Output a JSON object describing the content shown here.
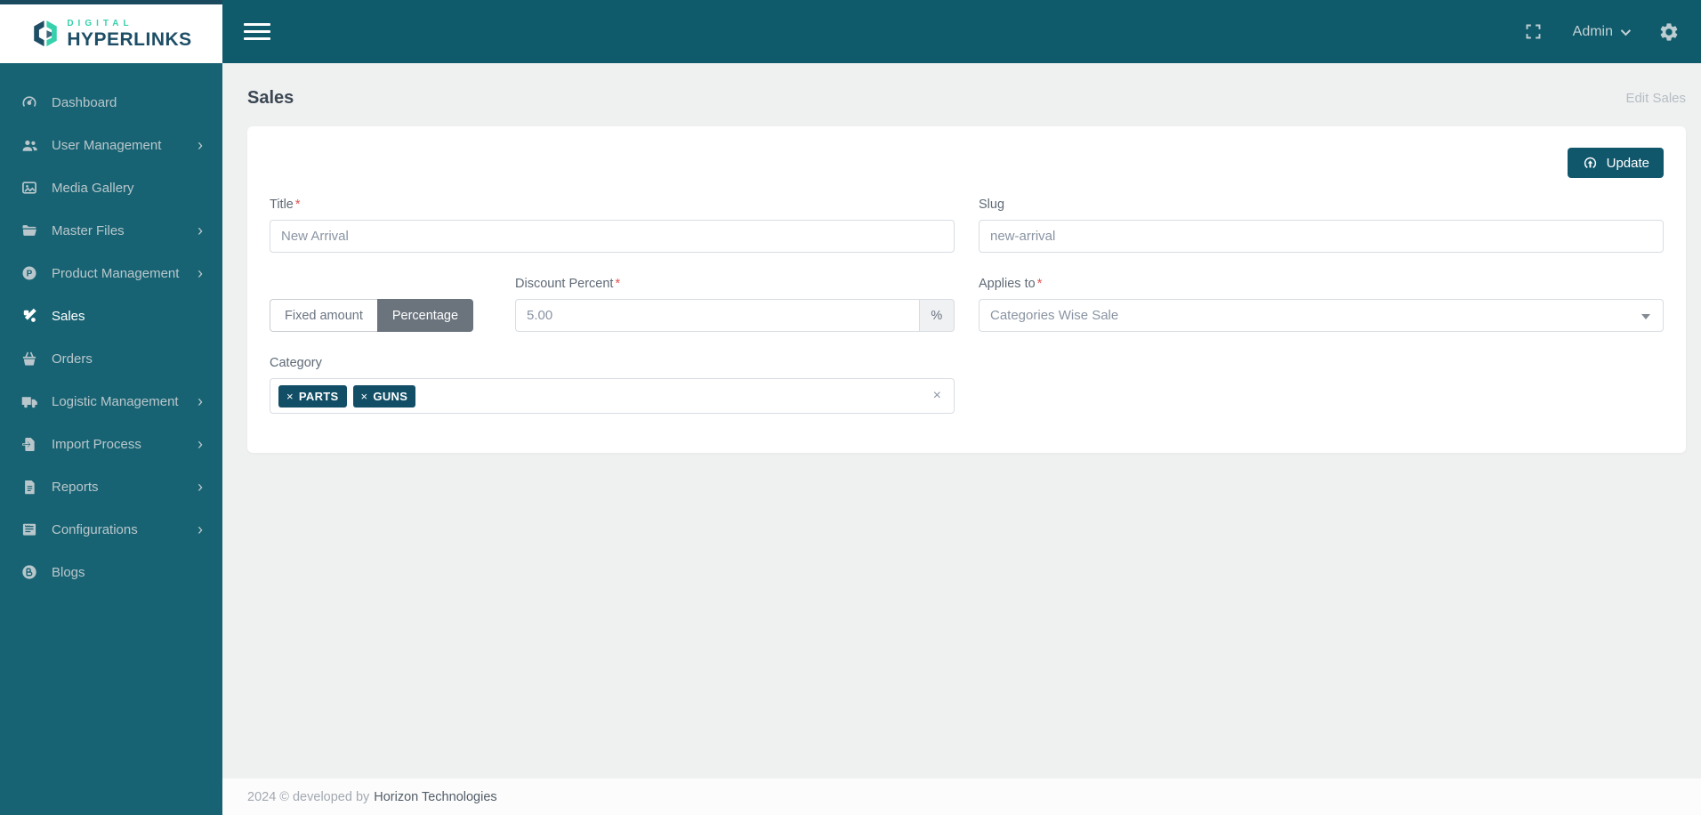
{
  "brand": {
    "digital": "DIGITAL",
    "hyperlinks": "HYPERLINKS"
  },
  "topbar": {
    "user_label": "Admin",
    "icons": [
      "fullscreen-icon",
      "gear-icon"
    ]
  },
  "sidebar": {
    "chevron": "›",
    "items": [
      {
        "label": "Dashboard",
        "icon": "gauge-icon",
        "expandable": false,
        "active": false
      },
      {
        "label": "User Management",
        "icon": "users-icon",
        "expandable": true,
        "active": false
      },
      {
        "label": "Media Gallery",
        "icon": "image-icon",
        "expandable": false,
        "active": false
      },
      {
        "label": "Master Files",
        "icon": "folder-icon",
        "expandable": true,
        "active": false
      },
      {
        "label": "Product Management",
        "icon": "product-icon",
        "expandable": true,
        "active": false
      },
      {
        "label": "Sales",
        "icon": "percent-icon",
        "expandable": false,
        "active": true
      },
      {
        "label": "Orders",
        "icon": "basket-icon",
        "expandable": false,
        "active": false
      },
      {
        "label": "Logistic Management",
        "icon": "truck-icon",
        "expandable": true,
        "active": false
      },
      {
        "label": "Import Process",
        "icon": "import-icon",
        "expandable": true,
        "active": false
      },
      {
        "label": "Reports",
        "icon": "report-icon",
        "expandable": true,
        "active": false
      },
      {
        "label": "Configurations",
        "icon": "config-icon",
        "expandable": true,
        "active": false
      },
      {
        "label": "Blogs",
        "icon": "blog-icon",
        "expandable": false,
        "active": false
      }
    ]
  },
  "page": {
    "title": "Sales",
    "subtitle": "Edit Sales"
  },
  "form": {
    "required_mark": "*",
    "update_label": "Update",
    "title": {
      "label": "Title",
      "value": "New Arrival"
    },
    "slug": {
      "label": "Slug",
      "value": "new-arrival"
    },
    "discount_type": {
      "fixed_label": "Fixed amount",
      "percentage_label": "Percentage",
      "selected": "Percentage"
    },
    "discount_percent": {
      "label": "Discount Percent",
      "value": "5.00",
      "suffix": "%"
    },
    "applies_to": {
      "label": "Applies to",
      "value": "Categories Wise Sale"
    },
    "category": {
      "label": "Category",
      "tags": [
        "PARTS",
        "GUNS"
      ],
      "remove_mark": "×",
      "clear": "×"
    }
  },
  "footer": {
    "text": "2024 © developed by",
    "link": "Horizon Technologies"
  },
  "colors": {
    "topbar": "#0f5a6b",
    "sidebar": "#186373",
    "accent_button": "#11576c",
    "tag": "#124f66",
    "brand_mint": "#36d1ac",
    "brand_navy": "#1d4e66",
    "required": "#e55353",
    "content_bg": "#eff0f0"
  }
}
